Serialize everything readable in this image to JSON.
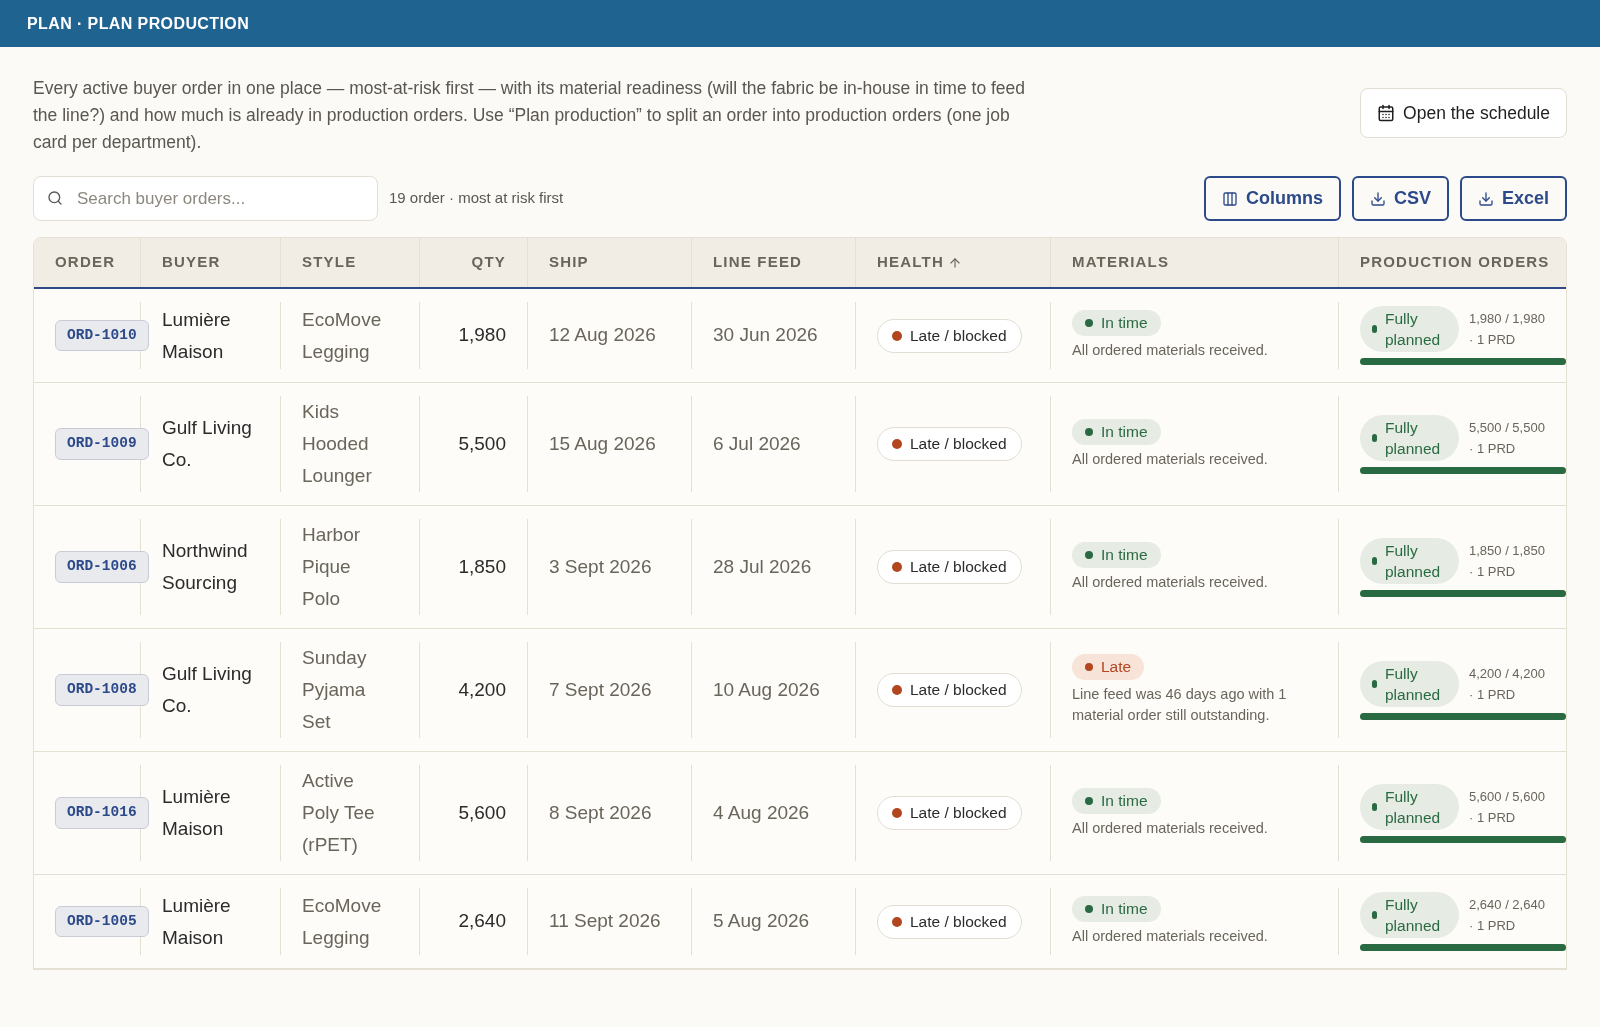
{
  "header": {
    "title": "PLAN · PLAN PRODUCTION"
  },
  "intro": "Every active buyer order in one place — most-at-risk first — with its material readiness (will the fabric be in-house in time to feed the line?) and how much is already in production orders. Use “Plan production” to split an order into production orders (one job card per department).",
  "schedule_button": "Open the schedule",
  "search": {
    "placeholder": "Search buyer orders..."
  },
  "count": "19 order · most at risk first",
  "toolbar": [
    "Columns",
    "CSV",
    "Excel"
  ],
  "table": {
    "columns": [
      {
        "label": "ORDER"
      },
      {
        "label": "BUYER"
      },
      {
        "label": "STYLE"
      },
      {
        "label": "QTY"
      },
      {
        "label": "SHIP"
      },
      {
        "label": "LINE FEED"
      },
      {
        "label": "HEALTH",
        "sorted": true
      },
      {
        "label": "MATERIALS"
      },
      {
        "label": "PRODUCTION ORDERS"
      }
    ],
    "rows": [
      {
        "order": "ORD-1010",
        "buyer": "Lumière Maison",
        "style": "EcoMove Legging",
        "qty": "1,980",
        "ship": "12 Aug 2026",
        "line_feed": "30 Jun 2026",
        "health": {
          "kind": "late",
          "label": "Late / blocked"
        },
        "materials": {
          "kind": "in_time",
          "label": "In time",
          "note": "All ordered materials received."
        },
        "production": {
          "status": "Fully planned",
          "qty": "1,980 / 1,980",
          "count": "· 1 PRD",
          "level": 1
        }
      },
      {
        "order": "ORD-1009",
        "buyer": "Gulf Living Co.",
        "style": "Kids Hooded Lounger",
        "qty": "5,500",
        "ship": "15 Aug 2026",
        "line_feed": "6 Jul 2026",
        "health": {
          "kind": "late",
          "label": "Late / blocked"
        },
        "materials": {
          "kind": "in_time",
          "label": "In time",
          "note": "All ordered materials received."
        },
        "production": {
          "status": "Fully planned",
          "qty": "5,500 / 5,500",
          "count": "· 1 PRD",
          "level": 1
        }
      },
      {
        "order": "ORD-1006",
        "buyer": "Northwind Sourcing",
        "style": "Harbor Pique Polo",
        "qty": "1,850",
        "ship": "3 Sept 2026",
        "line_feed": "28 Jul 2026",
        "health": {
          "kind": "late",
          "label": "Late / blocked"
        },
        "materials": {
          "kind": "in_time",
          "label": "In time",
          "note": "All ordered materials received."
        },
        "production": {
          "status": "Fully planned",
          "qty": "1,850 / 1,850",
          "count": "· 1 PRD",
          "level": 1
        }
      },
      {
        "order": "ORD-1008",
        "buyer": "Gulf Living Co.",
        "style": "Sunday Pyjama Set",
        "qty": "4,200",
        "ship": "7 Sept 2026",
        "line_feed": "10 Aug 2026",
        "health": {
          "kind": "late",
          "label": "Late / blocked"
        },
        "materials": {
          "kind": "late",
          "label": "Late",
          "note": "Line feed was 46 days ago with 1 material order still outstanding."
        },
        "production": {
          "status": "Fully planned",
          "qty": "4,200 / 4,200",
          "count": "· 1 PRD",
          "level": 1
        }
      },
      {
        "order": "ORD-1016",
        "buyer": "Lumière Maison",
        "style": "Active Poly Tee (rPET)",
        "qty": "5,600",
        "ship": "8 Sept 2026",
        "line_feed": "4 Aug 2026",
        "health": {
          "kind": "late",
          "label": "Late / blocked"
        },
        "materials": {
          "kind": "in_time",
          "label": "In time",
          "note": "All ordered materials received."
        },
        "production": {
          "status": "Fully planned",
          "qty": "5,600 / 5,600",
          "count": "· 1 PRD",
          "level": 1
        }
      },
      {
        "order": "ORD-1005",
        "buyer": "Lumière Maison",
        "style": "EcoMove Legging",
        "qty": "2,640",
        "ship": "11 Sept 2026",
        "line_feed": "5 Aug 2026",
        "health": {
          "kind": "late",
          "label": "Late / blocked"
        },
        "materials": {
          "kind": "in_time",
          "label": "In time",
          "note": "All ordered materials received."
        },
        "production": {
          "status": "Fully planned",
          "qty": "2,640 / 2,640",
          "count": "· 1 PRD",
          "level": 1
        }
      }
    ]
  }
}
